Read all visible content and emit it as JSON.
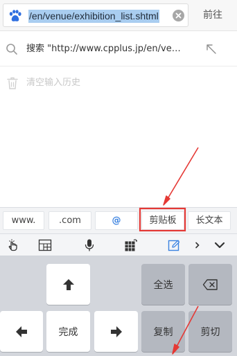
{
  "url_bar": {
    "logo_icon": "baidu-paw-icon",
    "url_text": "/en/venue/exhibition_list.shtml",
    "clear_icon": "clear-circle-icon",
    "go_label": "前往"
  },
  "suggestions": [
    {
      "icon": "search-icon",
      "text": "搜索 \"http://www.cpplus.jp/en/ve…",
      "action_icon": "arrow-up-left-icon"
    }
  ],
  "clear_history": {
    "icon": "trash-icon",
    "label": "清空输入历史"
  },
  "keyboard": {
    "quick_keys": [
      "www.",
      ".com",
      "@",
      "剪贴板",
      "长文本"
    ],
    "toolbar_icons": [
      "hand-cursor-icon",
      "layout-grid-icon",
      "microphone-icon",
      "numpad-icon",
      "edit-pen-icon",
      "chevron-right-icon",
      "chevron-down-icon"
    ],
    "keys": {
      "up": "up-arrow-icon",
      "select_all": "全选",
      "backspace": "backspace-icon",
      "left": "left-arrow-icon",
      "done": "完成",
      "right": "right-arrow-icon",
      "copy": "复制",
      "cut": "剪切"
    }
  },
  "colors": {
    "annotation_red": "#e53935",
    "selection_blue": "#a9cdf0",
    "accent_blue": "#3b82e0"
  }
}
